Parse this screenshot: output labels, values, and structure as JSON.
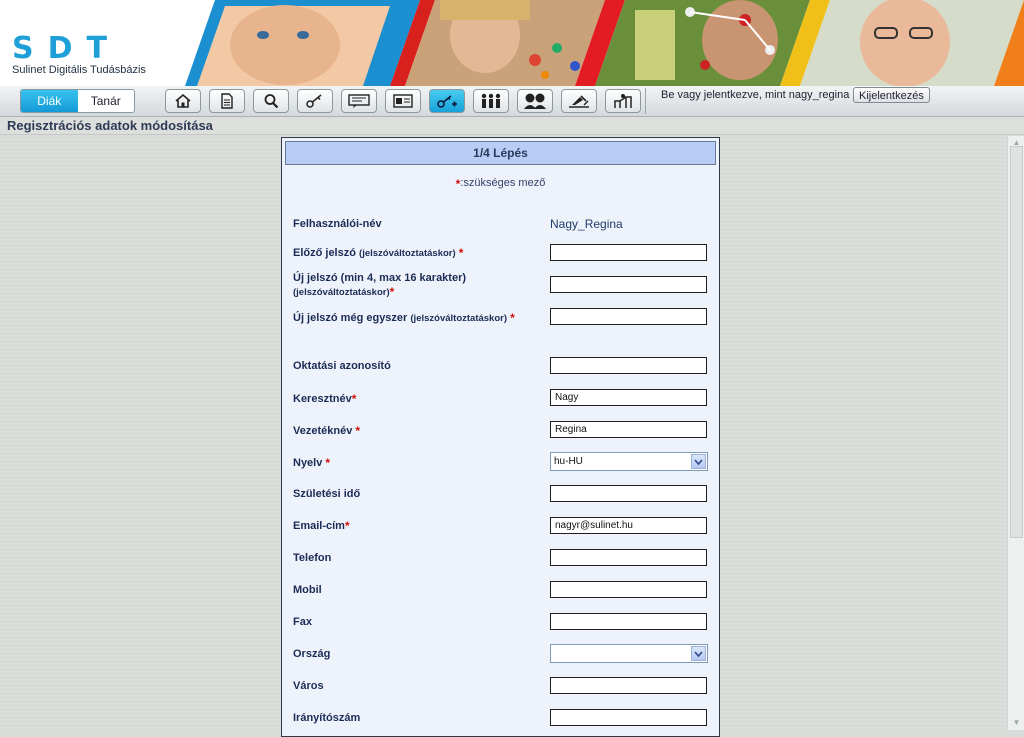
{
  "brand": {
    "logo_text": "SDT",
    "logo_subtitle": "Sulinet Digitális Tudásbázis"
  },
  "toolbar": {
    "roles": [
      {
        "label": "Diák",
        "active": true
      },
      {
        "label": "Tanár",
        "active": false
      }
    ],
    "buttons": [
      {
        "icon": "home-icon"
      },
      {
        "icon": "document-icon"
      },
      {
        "icon": "search-icon"
      },
      {
        "icon": "key-icon"
      },
      {
        "icon": "message-icon"
      },
      {
        "icon": "id-card-icon"
      },
      {
        "icon": "key-settings-icon",
        "active": true
      },
      {
        "icon": "group-icon"
      },
      {
        "icon": "users-icon"
      },
      {
        "icon": "tools-icon"
      },
      {
        "icon": "settings-icon"
      }
    ],
    "login_text": "Be vagy jelentkezve, mint nagy_regina",
    "logout_label": "Kijelentkezés"
  },
  "page_title": "Regisztrációs adatok módosítása",
  "form": {
    "step_header": "1/4 Lépés",
    "required_note_star": "*",
    "required_note": ":szükséges mező",
    "fields": {
      "username": {
        "label": "Felhasználói-név",
        "value": "Nagy_Regina"
      },
      "old_password": {
        "label": "Előző jelszó",
        "hint": "(jelszóváltoztatáskor)",
        "required": true,
        "value": ""
      },
      "new_password": {
        "label": "Új jelszó (min 4, max 16 karakter)",
        "hint": "(jelszóváltoztatáskor)",
        "required": true,
        "value": ""
      },
      "new_password_again": {
        "label": "Új jelszó még egyszer",
        "hint": "(jelszóváltoztatáskor)",
        "required": true,
        "value": ""
      },
      "education_id": {
        "label": "Oktatási azonosító",
        "value": ""
      },
      "first_name": {
        "label": "Keresztnév",
        "required": true,
        "value": "Nagy"
      },
      "last_name": {
        "label": "Vezetéknév",
        "required": true,
        "value": "Regina"
      },
      "language": {
        "label": "Nyelv",
        "required": true,
        "value": "hu-HU"
      },
      "birth_date": {
        "label": "Születési idő",
        "value": ""
      },
      "email": {
        "label": "Email-cím",
        "required": true,
        "value": "nagyr@sulinet.hu"
      },
      "phone": {
        "label": "Telefon",
        "value": ""
      },
      "mobile": {
        "label": "Mobil",
        "value": ""
      },
      "fax": {
        "label": "Fax",
        "value": ""
      },
      "country": {
        "label": "Ország",
        "value": ""
      },
      "city": {
        "label": "Város",
        "value": ""
      },
      "zip": {
        "label": "Irányítószám",
        "value": ""
      }
    }
  },
  "colors": {
    "accent": "#1499d6",
    "required_star": "#d01010",
    "panel_header": "#b7cdf5"
  }
}
